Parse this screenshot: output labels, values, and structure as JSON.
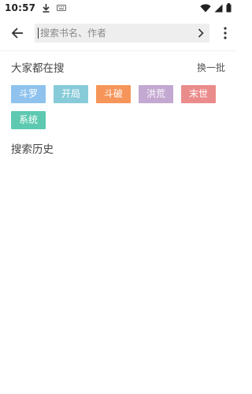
{
  "status": {
    "time": "10:57",
    "left_icons": [
      "download-icon",
      "keyboard-icon"
    ],
    "right_icons": [
      "wifi-icon",
      "cell-signal-icon",
      "battery-icon"
    ]
  },
  "search": {
    "placeholder": "搜索书名、作者",
    "value": ""
  },
  "hot": {
    "title": "大家都在搜",
    "refresh_label": "换一批",
    "tags": [
      {
        "label": "斗罗",
        "color": "#8fc3ee"
      },
      {
        "label": "开局",
        "color": "#88cbd8"
      },
      {
        "label": "斗破",
        "color": "#f6955a"
      },
      {
        "label": "洪荒",
        "color": "#c3a8d1"
      },
      {
        "label": "末世",
        "color": "#eb8c8c"
      },
      {
        "label": "系统",
        "color": "#5dc9b0"
      }
    ]
  },
  "history": {
    "title": "搜索历史"
  }
}
